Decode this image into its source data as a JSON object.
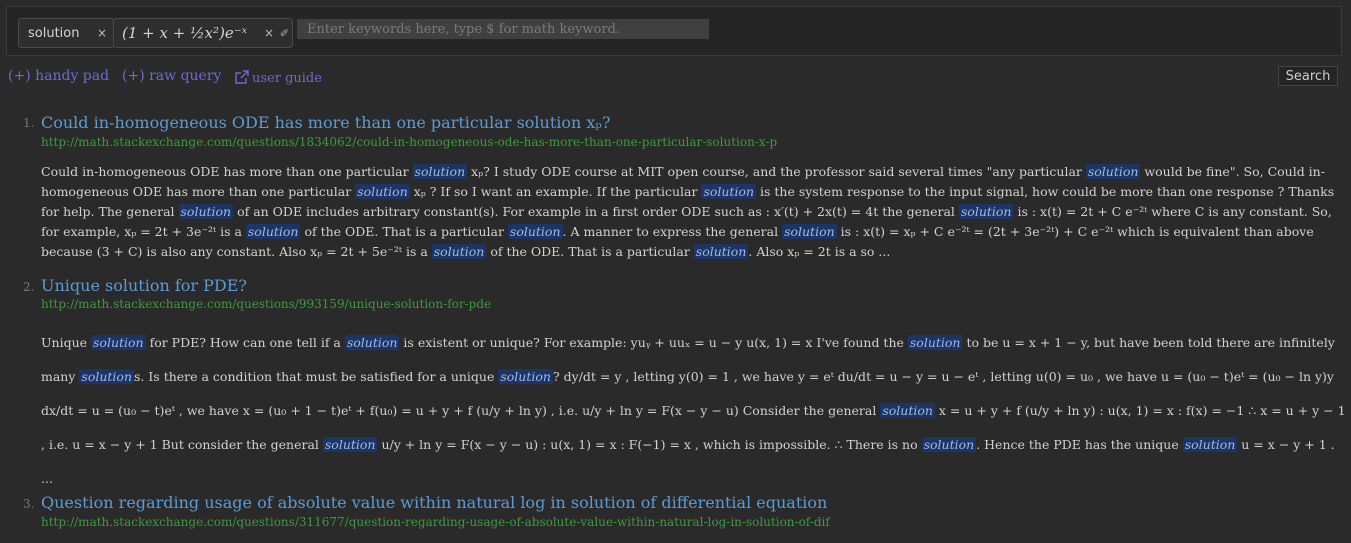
{
  "query": {
    "tags": [
      {
        "label": "solution"
      },
      {
        "label": "(1 + x + ½x²)e⁻ˣ"
      }
    ],
    "close_glyph": "×",
    "edit_glyph": "✐",
    "placeholder": "Enter keywords here, type $ for math keyword."
  },
  "tools": {
    "handy_pad": "(+) handy pad",
    "raw_query": "(+) raw query",
    "user_guide": "user guide",
    "search_label": "Search"
  },
  "highlight_term": "solution",
  "results": [
    {
      "num": "1.",
      "title": "Could in-homogeneous ODE has more than one particular solution xₚ?",
      "url": "http://math.stackexchange.com/questions/1834062/could-in-homogeneous-ode-has-more-than-one-particular-solution-x-p",
      "snippet": "Could in-homogeneous ODE has more than one particular solution xₚ? I study ODE course at MIT open course, and the professor said several times \"any particular solution would be fine\". So, Could in-homogeneous ODE has more than one particular solution xₚ ? If so I want an example. If the particular solution is the system response to the input signal, how could be more than one response ? Thanks for help. The general solution of an ODE includes arbitrary constant(s). For example in a first order ODE such as : x′(t) + 2x(t) = 4t the general solution is : x(t) = 2t + C e⁻²ᵗ where C is any constant. So, for example, xₚ = 2t + 3e⁻²ᵗ is a solution of the ODE. That is a particular solution. A manner to express the general solution is : x(t) = xₚ + C e⁻²ᵗ = (2t + 3e⁻²ᵗ) + C e⁻²ᵗ which is equivalent than above because (3 + C) is also any constant. Also xₚ = 2t + 5e⁻²ᵗ is a solution of the ODE. That is a particular solution. Also xₚ = 2t is a so ..."
    },
    {
      "num": "2.",
      "title": "Unique solution for PDE?",
      "url": "http://math.stackexchange.com/questions/993159/unique-solution-for-pde",
      "snippet": "Unique solution for PDE? How can one tell if a solution is existent or unique? For example: yuᵧ + uuₓ = u − y u(x, 1) = x I've found the solution to be u = x + 1 − y, but have been told there are infinitely many solutions. Is there a condition that must be satisfied for a unique solution? dy/dt = y , letting y(0) = 1 , we have y = eᵗ du/dt = u − y = u − eᵗ , letting u(0) = u₀ , we have u = (u₀ − t)eᵗ = (u₀ − ln y)y dx/dt = u = (u₀ − t)eᵗ , we have x = (u₀ + 1 − t)eᵗ + f(u₀) = u + y + f (u/y + ln y) , i.e. u/y + ln y = F(x − y − u) Consider the general solution x = u + y + f (u/y + ln y) : u(x, 1) = x : f(x) = −1 ∴ x = u + y − 1 , i.e. u = x − y + 1 But consider the general solution u/y + ln y = F(x − y − u) : u(x, 1) = x : F(−1) = x , which is impossible. ∴ There is no solution. Hence the PDE has the unique solution u = x − y + 1 . ..."
    },
    {
      "num": "3.",
      "title": "Question regarding usage of absolute value within natural log in solution of differential equation",
      "url": "http://math.stackexchange.com/questions/311677/question-regarding-usage-of-absolute-value-within-natural-log-in-solution-of-dif",
      "snippet": ""
    }
  ]
}
